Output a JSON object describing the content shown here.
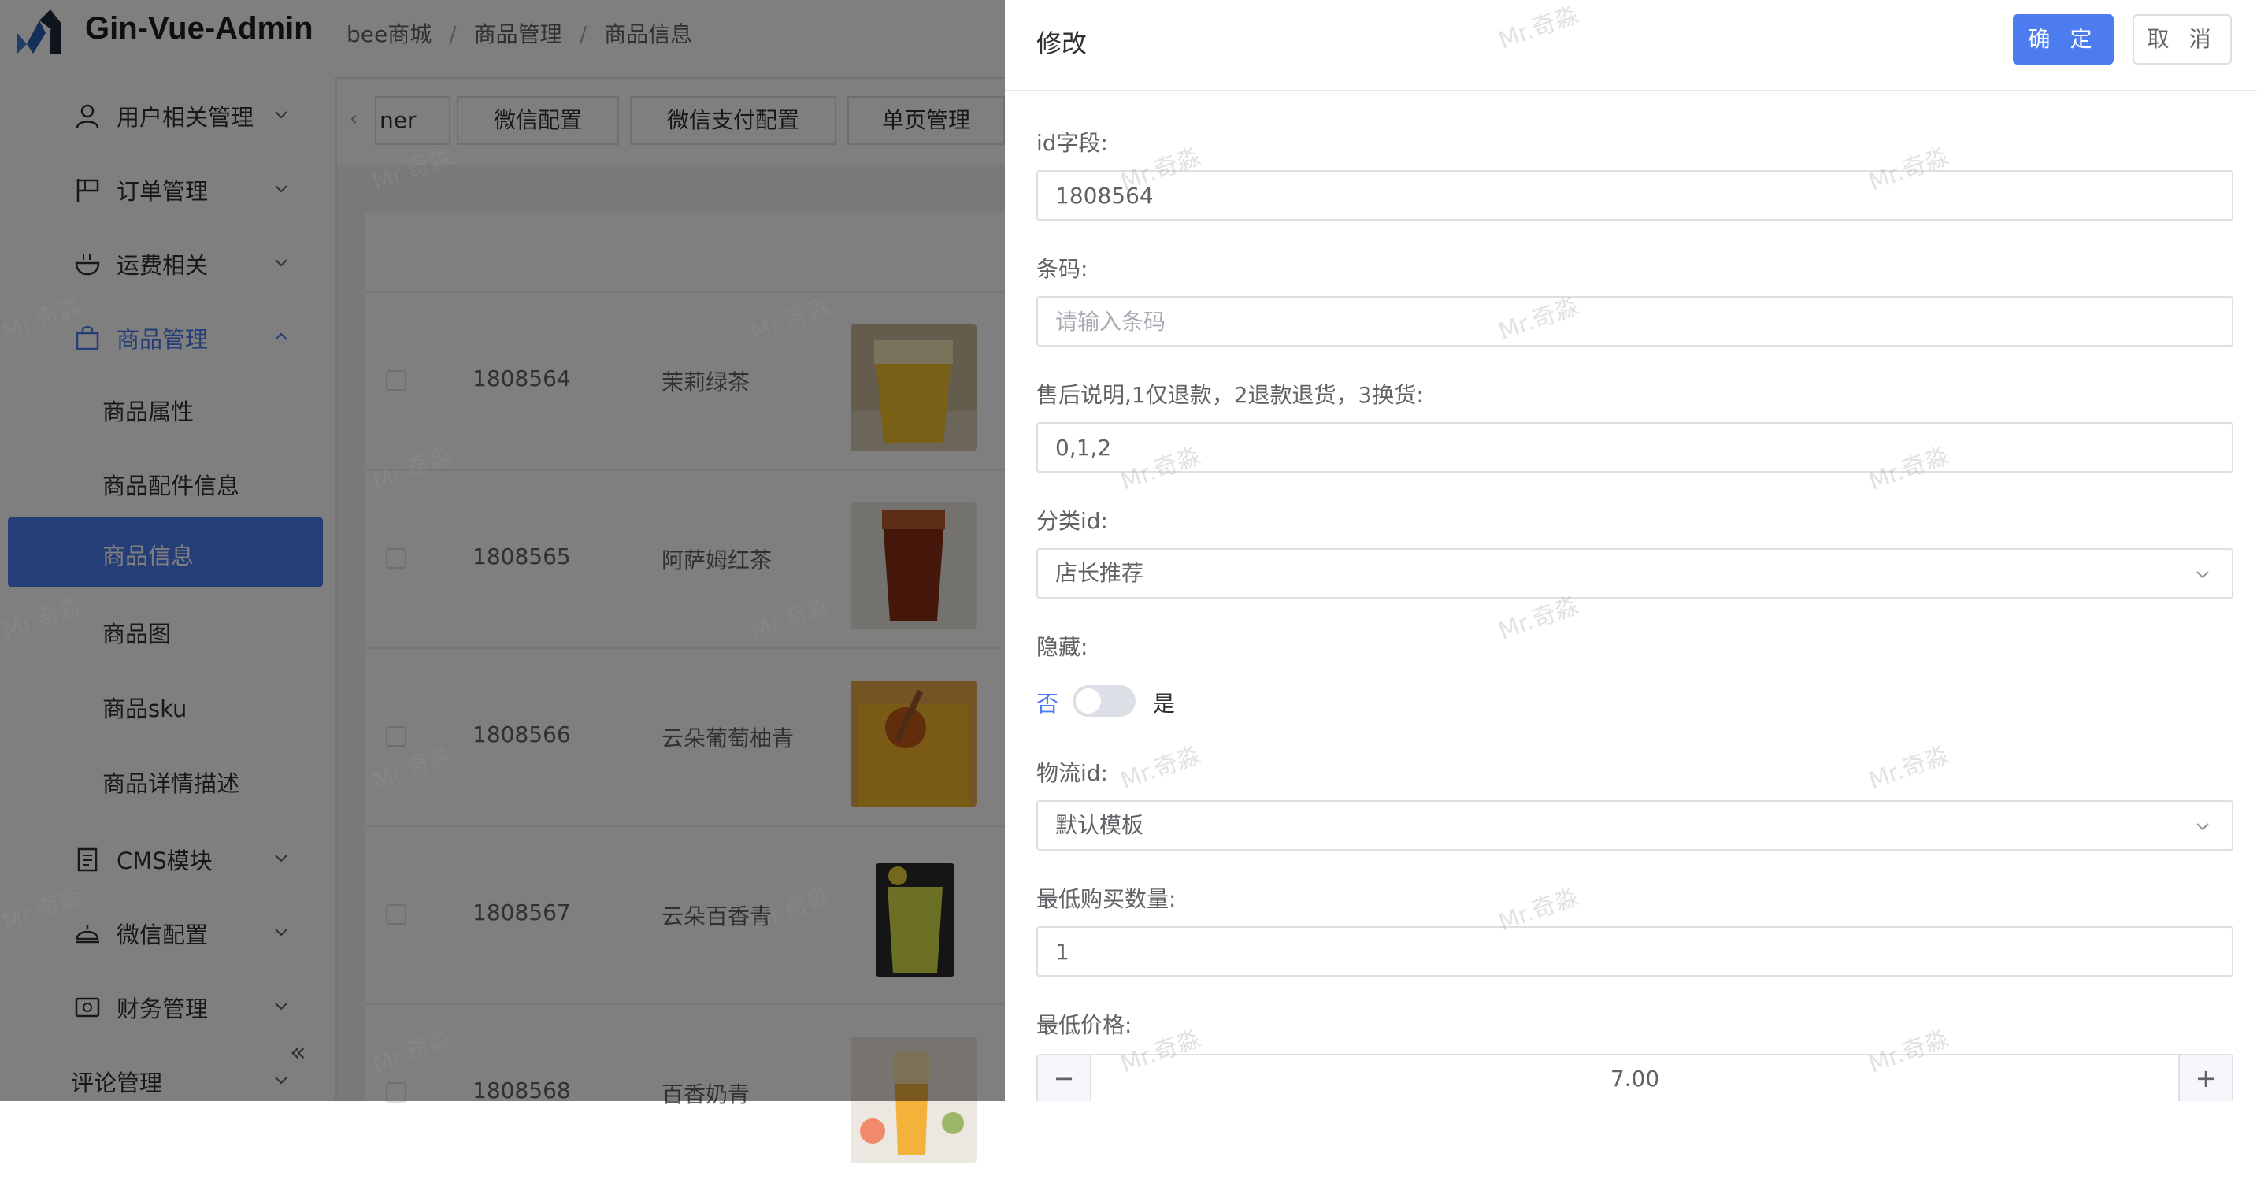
{
  "app": {
    "title": "Gin-Vue-Admin",
    "breadcrumb": [
      "bee商城",
      "商品管理",
      "商品信息"
    ]
  },
  "sidebar": {
    "items": [
      {
        "label": "用户相关管理",
        "icon": "user-icon"
      },
      {
        "label": "订单管理",
        "icon": "flag-icon"
      },
      {
        "label": "运费相关",
        "icon": "bowl-icon"
      },
      {
        "label": "商品管理",
        "icon": "bag-icon",
        "expanded": true
      },
      {
        "label": "CMS模块",
        "icon": "document-icon"
      },
      {
        "label": "微信配置",
        "icon": "dish-icon"
      },
      {
        "label": "财务管理",
        "icon": "wallet-icon"
      },
      {
        "label": "评论管理"
      }
    ],
    "sub_items": [
      "商品属性",
      "商品配件信息",
      "商品信息",
      "商品图",
      "商品sku",
      "商品详情描述"
    ],
    "active_sub": "商品信息",
    "collapse_glyph": "«"
  },
  "tabs": [
    "ner",
    "微信配置",
    "微信支付配置",
    "单页管理"
  ],
  "table": {
    "rows": [
      {
        "id": "1808564",
        "name": "茉莉绿茶",
        "image": "jasmine-tea"
      },
      {
        "id": "1808565",
        "name": "阿萨姆红茶",
        "image": "assam-tea"
      },
      {
        "id": "1808566",
        "name": "云朵葡萄柚青",
        "image": "grapefruit-tea"
      },
      {
        "id": "1808567",
        "name": "云朵百香青",
        "image": "passionfruit-tea"
      },
      {
        "id": "1808568",
        "name": "百香奶青",
        "image": "passionfruit-milk-tea"
      }
    ]
  },
  "drawer": {
    "title": "修改",
    "confirm_label": "确 定",
    "cancel_label": "取 消",
    "fields": {
      "id": {
        "label": "id字段:",
        "value": "1808564"
      },
      "barcode": {
        "label": "条码:",
        "value": "",
        "placeholder": "请输入条码"
      },
      "after_sale": {
        "label": "售后说明,1仅退款，2退款退货，3换货:",
        "value": "0,1,2"
      },
      "category": {
        "label": "分类id:",
        "value": "店长推荐"
      },
      "hidden": {
        "label": "隐藏:",
        "off_label": "否",
        "on_label": "是",
        "checked": false
      },
      "logistics": {
        "label": "物流id:",
        "value": "默认模板"
      },
      "min_qty": {
        "label": "最低购买数量:",
        "value": "1"
      },
      "min_price": {
        "label": "最低价格:",
        "value": "7.00",
        "minus": "−",
        "plus": "+"
      }
    }
  },
  "watermark": "Mr.奇淼",
  "colors": {
    "primary": "#4c7cf0",
    "mask": "rgba(0,0,0,0.5)"
  }
}
